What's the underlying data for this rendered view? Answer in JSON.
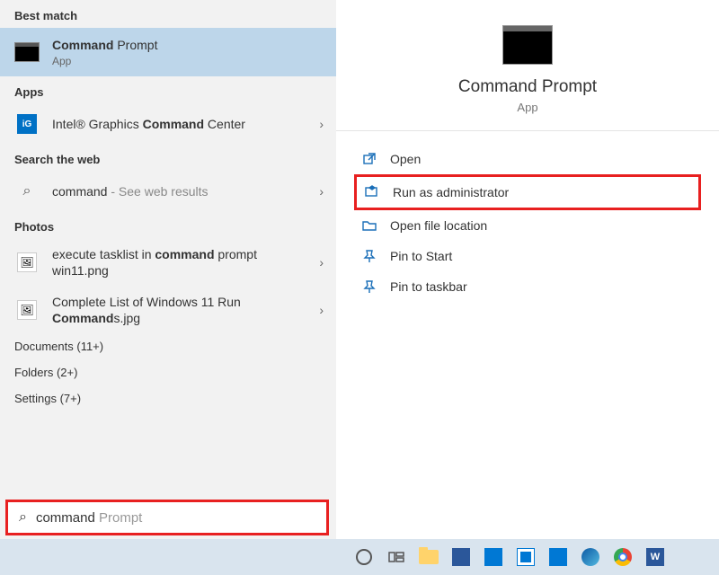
{
  "left": {
    "best_match_label": "Best match",
    "best": {
      "title_bold": "Command",
      "title_rest": " Prompt",
      "sub": "App"
    },
    "apps_label": "Apps",
    "apps": [
      {
        "pre": "Intel® Graphics ",
        "bold": "Command",
        "post": " Center"
      }
    ],
    "web_label": "Search the web",
    "web": {
      "query": "command",
      "hint": " - See web results"
    },
    "photos_label": "Photos",
    "photos": [
      {
        "pre": "execute tasklist in ",
        "bold": "command",
        "post": " prompt win11.png"
      },
      {
        "pre": "Complete List of Windows 11 Run ",
        "bold": "Command",
        "post": "s.jpg"
      }
    ],
    "categories": [
      "Documents (11+)",
      "Folders (2+)",
      "Settings (7+)"
    ]
  },
  "right": {
    "title": "Command Prompt",
    "type": "App",
    "actions": {
      "open": "Open",
      "run_admin": "Run as administrator",
      "open_loc": "Open file location",
      "pin_start": "Pin to Start",
      "pin_taskbar": "Pin to taskbar"
    }
  },
  "search": {
    "typed": "command",
    "ghost": " Prompt"
  }
}
